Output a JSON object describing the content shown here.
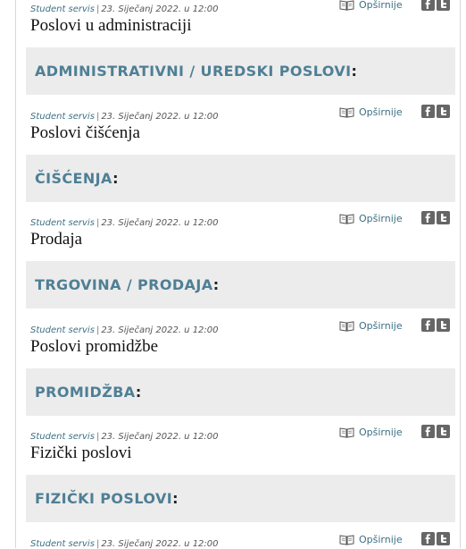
{
  "posts": [
    {
      "author": "Student servis",
      "date": "23. Siječanj 2022. u 12:00",
      "title": "Poslovi u administraciji",
      "more": "Opširnije",
      "category": "ADMINISTRATIVNI / UREDSKI POSLOVI"
    },
    {
      "author": "Student servis",
      "date": "23. Siječanj 2022. u 12:00",
      "title": "Poslovi čišćenja",
      "more": "Opširnije",
      "category": "ČIŠĆENJA"
    },
    {
      "author": "Student servis",
      "date": "23. Siječanj 2022. u 12:00",
      "title": "Prodaja",
      "more": "Opširnije",
      "category": "TRGOVINA / PRODAJA"
    },
    {
      "author": "Student servis",
      "date": "23. Siječanj 2022. u 12:00",
      "title": "Poslovi promidžbe",
      "more": "Opširnije",
      "category": "PROMIDŽBA"
    },
    {
      "author": "Student servis",
      "date": "23. Siječanj 2022. u 12:00",
      "title": "Fizički poslovi",
      "more": "Opširnije",
      "category": "FIZIČKI POSLOVI"
    },
    {
      "author": "Student servis",
      "date": "23. Siječanj 2022. u 12:00",
      "title": "",
      "more": "Opširnije",
      "category": ""
    }
  ],
  "separator": "|",
  "colon": ":",
  "icons": {
    "read_more": "book-icon",
    "facebook": "facebook-icon",
    "twitter": "twitter-icon"
  },
  "colors": {
    "link": "#3d6f83",
    "category": "#4f7f95",
    "band": "#ececec",
    "icon_bg": "#666666"
  }
}
